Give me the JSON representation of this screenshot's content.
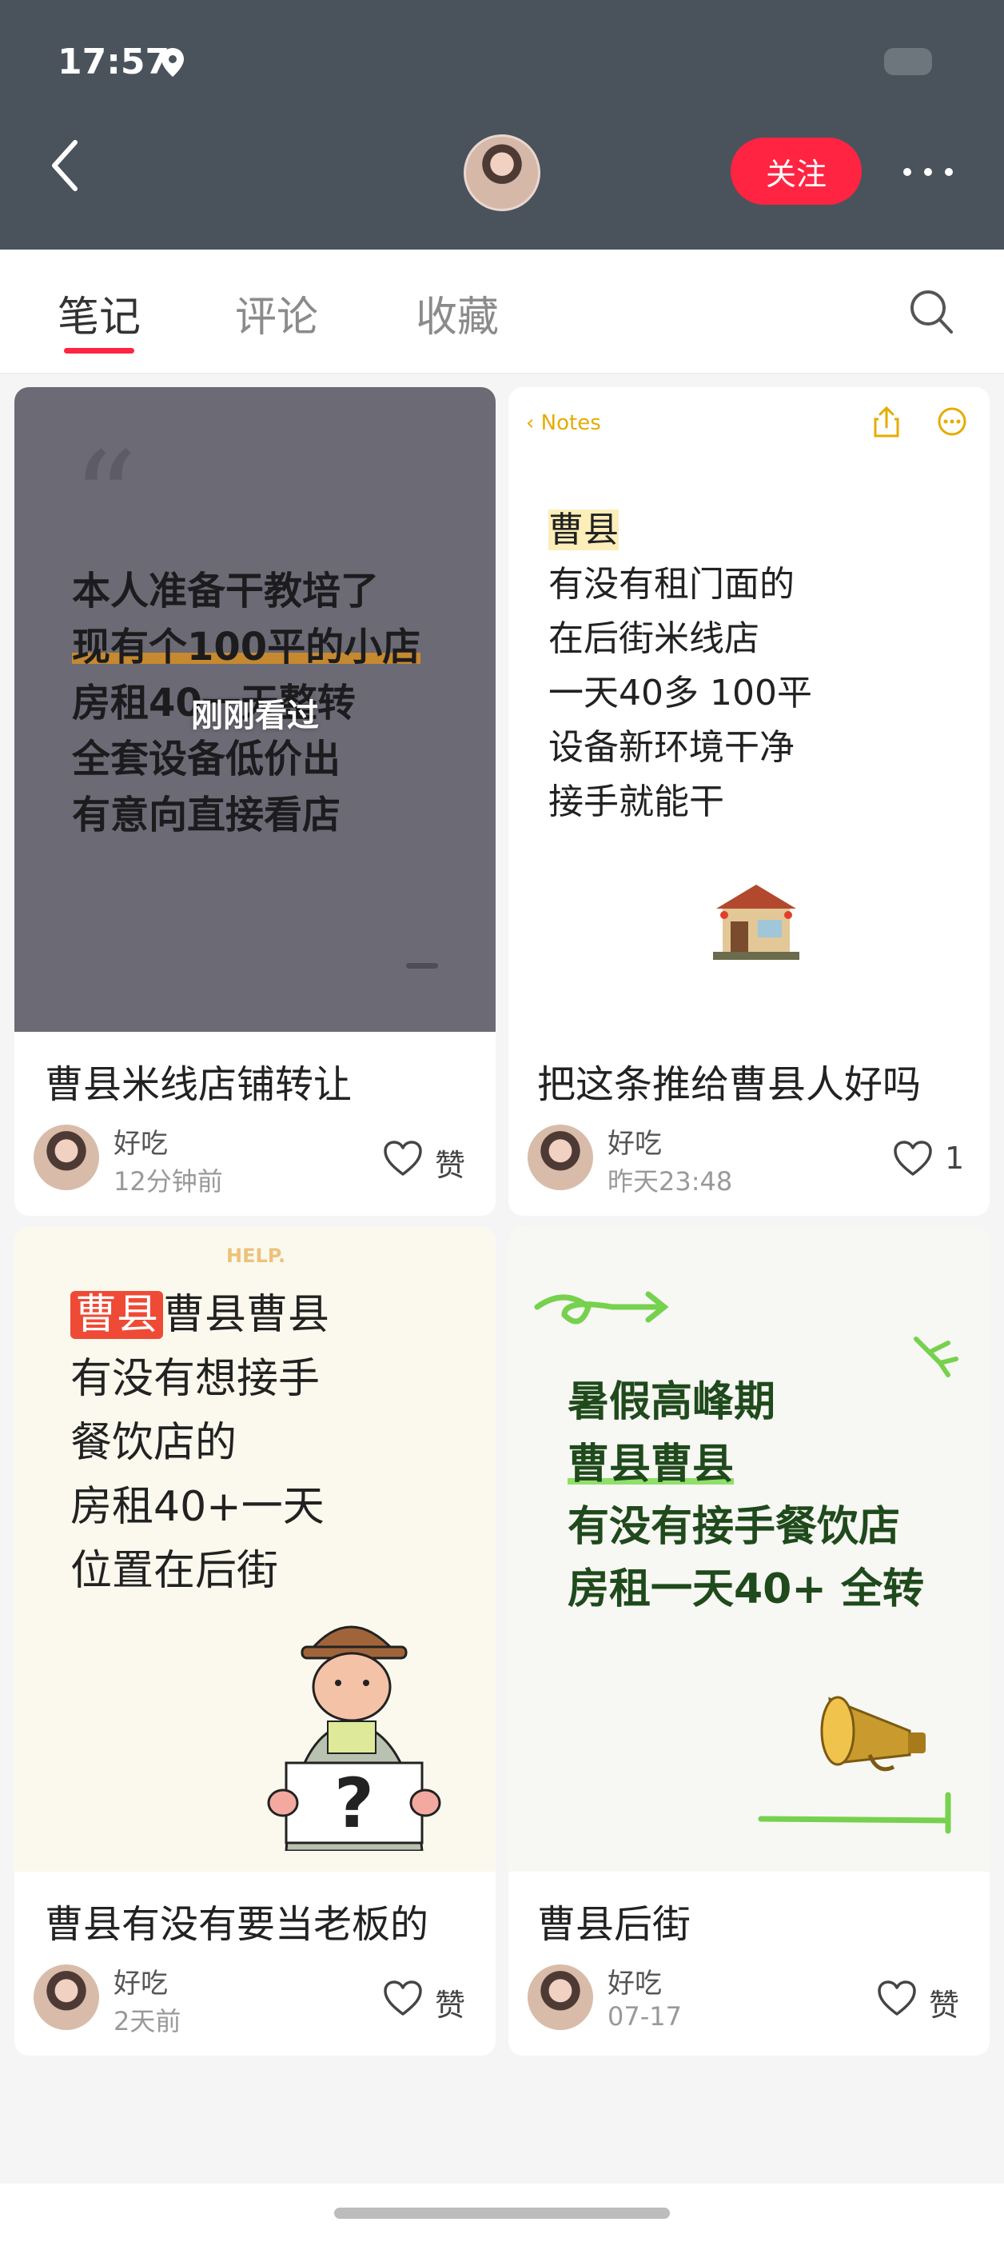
{
  "status_bar": {
    "time": "17:57"
  },
  "header": {
    "follow_label": "关注"
  },
  "tabs": [
    {
      "label": "笔记"
    },
    {
      "label": "评论"
    },
    {
      "label": "收藏"
    }
  ],
  "cards": [
    {
      "cover_lines": [
        "本人准备干教培了",
        "现有个100平的小店",
        "房租40一天整转",
        "全套设备低价出",
        "有意向直接看店"
      ],
      "seen_label": "刚刚看过",
      "title": "曹县米线店铺转让",
      "author": "好吃",
      "time": "12分钟前",
      "likes": "赞"
    },
    {
      "notes_back": "Notes",
      "cover_lines": [
        "曹县",
        "有没有租门面的",
        "在后街米线店",
        "一天40多 100平",
        "设备新环境干净",
        "接手就能干"
      ],
      "title": "把这条推给曹县人好吗",
      "author": "好吃",
      "time": "昨天23:48",
      "likes": "1"
    },
    {
      "help_tag": "HELP.",
      "cover_first_tag": "曹县",
      "cover_first_rest": "曹县曹县",
      "cover_lines": [
        "有没有想接手",
        "餐饮店的",
        "房租40+一天",
        "位置在后街"
      ],
      "title": "曹县有没有要当老板的",
      "author": "好吃",
      "time": "2天前",
      "likes": "赞"
    },
    {
      "cover_lines": [
        "暑假高峰期",
        "曹县曹县",
        "有没有接手餐饮店",
        "房租一天40+ 全转"
      ],
      "title": "曹县后街",
      "author": "好吃",
      "time": "07-17",
      "likes": "赞"
    }
  ],
  "colors": {
    "accent": "#ff2442",
    "header_bg": "#4a535c"
  },
  "icons": [
    "pin-icon",
    "back-icon",
    "more-icon",
    "search-icon",
    "heart-icon",
    "share-icon",
    "options-icon"
  ]
}
